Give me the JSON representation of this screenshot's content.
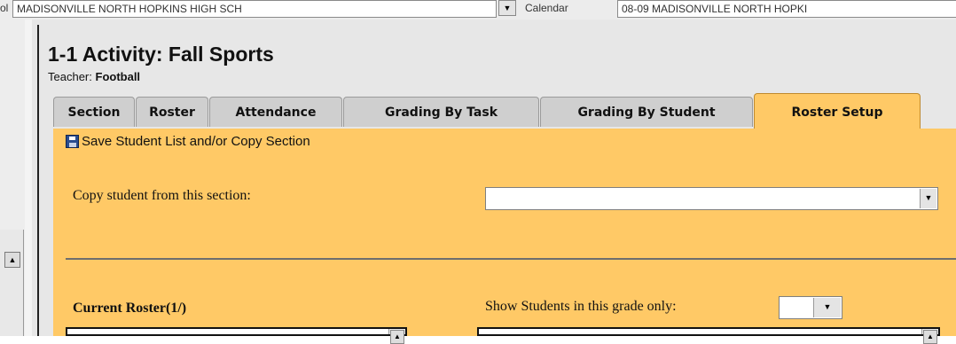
{
  "topbar": {
    "school_prefix": "ol",
    "school_value": "MADISONVILLE NORTH HOPKINS HIGH SCH",
    "calendar_label": "Calendar",
    "calendar_value": "08-09 MADISONVILLE NORTH HOPKI"
  },
  "page": {
    "title": "1-1 Activity: Fall Sports",
    "teacher_label": "Teacher:",
    "teacher_name": "Football"
  },
  "tabs": [
    {
      "label": "Section",
      "active": false
    },
    {
      "label": "Roster",
      "active": false
    },
    {
      "label": "Attendance",
      "active": false
    },
    {
      "label": "Grading By Task",
      "active": false
    },
    {
      "label": "Grading By Student",
      "active": false
    },
    {
      "label": "Roster Setup",
      "active": true
    }
  ],
  "toolbar": {
    "save_label": "Save Student List and/or Copy Section",
    "save_icon": "floppy-disk-icon"
  },
  "copy_section": {
    "label": "Copy student from this section:",
    "value": ""
  },
  "roster": {
    "current_label": "Current Roster(1/)",
    "grade_filter_label": "Show Students in this grade only:",
    "grade_filter_value": ""
  },
  "colors": {
    "tab_active": "#ffc966",
    "content_bg": "#ffc966",
    "tab_inactive": "#cfcfcf",
    "panel_bg": "#e7e7e7"
  }
}
